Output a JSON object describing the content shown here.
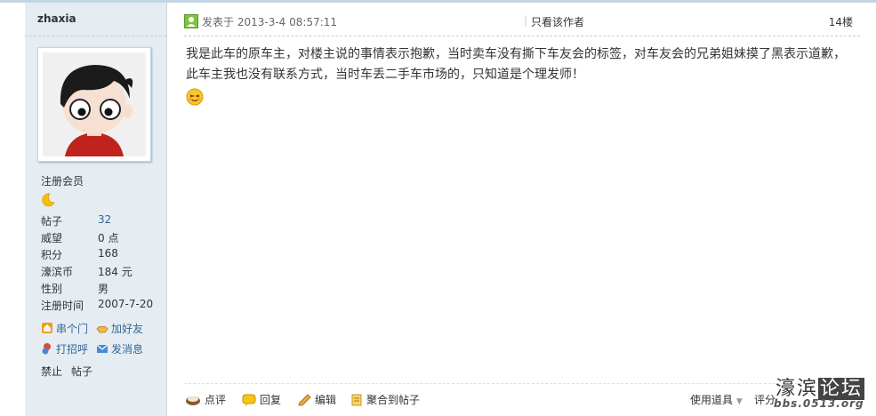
{
  "user": {
    "name": "zhaxia",
    "group": "注册会员",
    "stats": [
      {
        "label": "帖子",
        "value": "32"
      },
      {
        "label": "威望",
        "value": "0 点"
      },
      {
        "label": "积分",
        "value": "168"
      },
      {
        "label": "濠滨币",
        "value": "184 元"
      },
      {
        "label": "性别",
        "value": "男"
      },
      {
        "label": "注册时间",
        "value": "2007-7-20"
      }
    ],
    "actions": {
      "visit": "串个门",
      "add_friend": "加好友",
      "greet": "打招呼",
      "message": "发消息"
    },
    "ban": {
      "label1": "禁止",
      "label2": "帖子"
    }
  },
  "post": {
    "posted_prefix": "发表于",
    "posted_time": "2013-3-4 08:57:11",
    "separator": "|",
    "author_only": "只看该作者",
    "floor": "14楼",
    "content": "我是此车的原车主，对楼主说的事情表示抱歉，当时卖车没有撕下车友会的标签，对车友会的兄弟姐妹摸了黑表示道歉，此车主我也没有联系方式，当时车丢二手车市场的，只知道是个理发师！"
  },
  "footer": {
    "comment": "点评",
    "reply": "回复",
    "edit": "编辑",
    "aggregate": "聚合到帖子",
    "use_tool": "使用道具",
    "rate": "评分"
  },
  "watermark": {
    "title_a": "濠滨",
    "title_b": "论坛",
    "sub": "bbs.0513.org"
  },
  "colors": {
    "sidebar_bg": "#e5edf2",
    "border": "#c2d5e3",
    "link": "#336699"
  }
}
